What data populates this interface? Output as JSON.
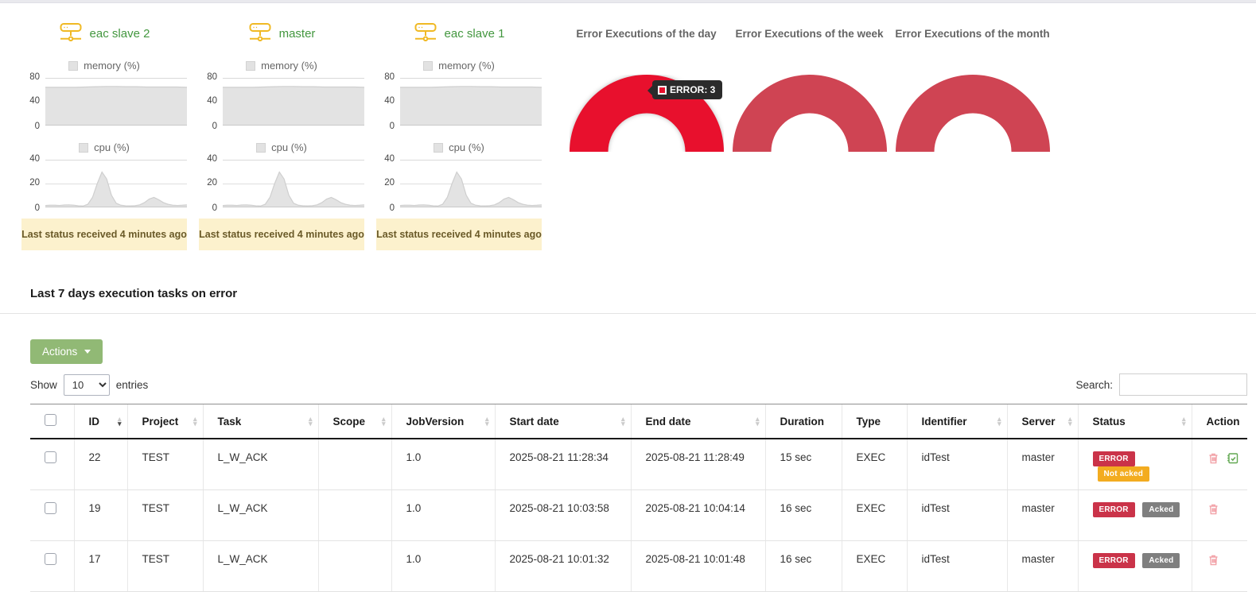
{
  "colors": {
    "green_text": "#43973f",
    "icon_yellow": "#f0b924",
    "gauge_red_active": "#e8102d",
    "gauge_red": "#cf4453",
    "banner_bg": "#fcf1cd",
    "actions_green": "#91b975",
    "badge_error": "#ca3349",
    "badge_not_acked": "#f3ac20",
    "badge_acked": "#7f7f7f"
  },
  "server_cards": {
    "banner_text": "Last status received 4 minutes ago",
    "cards": [
      {
        "name": "eac slave 2"
      },
      {
        "name": "master"
      },
      {
        "name": "eac slave 1"
      }
    ]
  },
  "section": {
    "title": "Last 7 days execution tasks on error"
  },
  "toolbar": {
    "actions_label": "Actions",
    "show_label": "Show",
    "page_size": "10",
    "entries_label": "entries",
    "search_label": "Search:"
  },
  "table": {
    "headers": {
      "id": "ID",
      "project": "Project",
      "task": "Task",
      "scope": "Scope",
      "job_version": "JobVersion",
      "start": "Start date",
      "end": "End date",
      "duration": "Duration",
      "type": "Type",
      "identifier": "Identifier",
      "server": "Server",
      "status": "Status",
      "action": "Action"
    },
    "rows": [
      {
        "id": "22",
        "project": "TEST",
        "task": "L_W_ACK",
        "scope": "",
        "job_version": "1.0",
        "start": "2025-08-21 11:28:34",
        "end": "2025-08-21 11:28:49",
        "duration": "15 sec",
        "type": "EXEC",
        "identifier": "idTest",
        "server": "master",
        "status": "ERROR",
        "ack_status": "Not acked"
      },
      {
        "id": "19",
        "project": "TEST",
        "task": "L_W_ACK",
        "scope": "",
        "job_version": "1.0",
        "start": "2025-08-21 10:03:58",
        "end": "2025-08-21 10:04:14",
        "duration": "16 sec",
        "type": "EXEC",
        "identifier": "idTest",
        "server": "master",
        "status": "ERROR",
        "ack_status": "Acked"
      },
      {
        "id": "17",
        "project": "TEST",
        "task": "L_W_ACK",
        "scope": "",
        "job_version": "1.0",
        "start": "2025-08-21 10:01:32",
        "end": "2025-08-21 10:01:48",
        "duration": "16 sec",
        "type": "EXEC",
        "identifier": "idTest",
        "server": "master",
        "status": "ERROR",
        "ack_status": "Acked"
      }
    ]
  },
  "chart_data": [
    {
      "type": "area",
      "title": "memory (%)",
      "ylim": [
        0,
        80
      ],
      "yticks": [
        "80",
        "40",
        "0"
      ],
      "values": [
        65,
        65,
        65,
        65,
        65.5,
        66,
        66.5,
        66.5,
        66,
        66,
        65.5,
        65.5,
        65.5,
        65.5,
        65
      ]
    },
    {
      "type": "area",
      "title": "cpu (%)",
      "ylim": [
        0,
        40
      ],
      "yticks": [
        "40",
        "20",
        "0"
      ],
      "values": [
        1,
        1.2,
        1.2,
        1,
        1.4,
        1.5,
        1.2,
        0.7,
        0.5,
        2,
        8,
        20,
        30,
        24,
        10,
        3,
        1.2,
        0.7,
        0.6,
        0.8,
        1.5,
        3.5,
        6.5,
        8,
        6,
        3.5,
        2,
        1.2,
        1,
        1.2,
        1.5
      ]
    },
    {
      "type": "gauge",
      "title": "Error Executions of the day",
      "color": "#e8102d",
      "series": [
        {
          "name": "ERROR",
          "value": 3
        }
      ],
      "tooltip": "ERROR: 3"
    },
    {
      "type": "gauge",
      "title": "Error Executions of the week",
      "color": "#cf4453",
      "series": [
        {
          "name": "ERROR"
        }
      ]
    },
    {
      "type": "gauge",
      "title": "Error Executions of the month",
      "color": "#cf4453",
      "series": [
        {
          "name": "ERROR"
        }
      ]
    }
  ]
}
